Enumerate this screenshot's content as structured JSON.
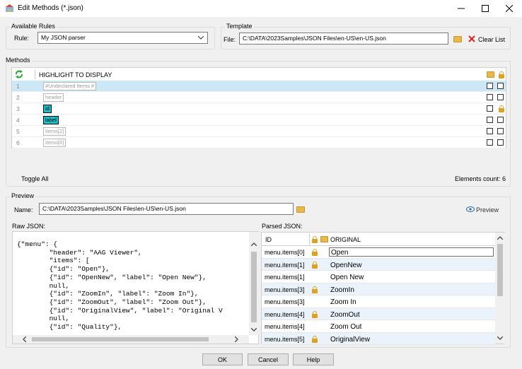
{
  "window": {
    "title": "Edit Methods (*.json)"
  },
  "available_rules": {
    "group_label": "Available Rules",
    "rule_label": "Rule:",
    "rule_value": "My JSON parser"
  },
  "template": {
    "group_label": "Template",
    "file_label": "File:",
    "file_value": "C:\\DATA\\2023Samples\\JSON Files\\en-US\\en-US.json",
    "clear_label": "Clear List"
  },
  "methods": {
    "group_label": "Methods",
    "header_label": "HIGHLIGHT TO DISPLAY",
    "rows": [
      {
        "num": "1",
        "tag": "#Undeclared Items #",
        "style": "placeholder",
        "lock": false
      },
      {
        "num": "2",
        "tag": "header",
        "style": "plain",
        "lock": false
      },
      {
        "num": "3",
        "tag": "id",
        "style": "teal",
        "lock": true
      },
      {
        "num": "4",
        "tag": "label",
        "style": "teal",
        "lock": false
      },
      {
        "num": "5",
        "tag": "items[2]",
        "style": "plain",
        "lock": false
      },
      {
        "num": "6",
        "tag": "items[6]",
        "style": "plain",
        "lock": false
      }
    ],
    "toggle_all": "Toggle All",
    "elements_count": "Elements count: 6"
  },
  "preview": {
    "group_label": "Preview",
    "name_label": "Name:",
    "name_value": "C:\\DATA\\2023Samples\\JSON Files\\en-US\\en-US.json",
    "preview_label": "Preview",
    "raw_label": "Raw JSON:",
    "raw_lines": [
      "{\"menu\": {",
      "        \"header\": \"AAG Viewer\",",
      "        \"items\": [",
      "        {\"id\": \"Open\"},",
      "        {\"id\": \"OpenNew\", \"label\": \"Open New\"},",
      "        null,",
      "        {\"id\": \"ZoomIn\", \"label\": \"Zoom In\"},",
      "        {\"id\": \"ZoomOut\", \"label\": \"Zoom Out\"},",
      "        {\"id\": \"OriginalView\", \"label\": \"Original V",
      "        null,",
      "        {\"id\": \"Quality\"},"
    ],
    "parsed_label": "Parsed JSON:",
    "col_id": "ID",
    "col_original": "ORIGINAL",
    "parsed_rows": [
      {
        "id": "menu.items[0]",
        "lock": true,
        "original": "Open",
        "selected": true
      },
      {
        "id": "menu.items[1]",
        "lock": true,
        "original": "OpenNew",
        "selected": false
      },
      {
        "id": "menu.items[1]",
        "lock": false,
        "original": "Open New",
        "selected": false
      },
      {
        "id": "menu.items[3]",
        "lock": true,
        "original": "ZoomIn",
        "selected": false
      },
      {
        "id": "menu.items[3]",
        "lock": false,
        "original": "Zoom In",
        "selected": false
      },
      {
        "id": "menu.items[4]",
        "lock": true,
        "original": "ZoomOut",
        "selected": false
      },
      {
        "id": "menu.items[4]",
        "lock": false,
        "original": "Zoom Out",
        "selected": false
      },
      {
        "id": "menu.items[5]",
        "lock": true,
        "original": "OriginalView",
        "selected": false
      }
    ]
  },
  "buttons": {
    "ok": "OK",
    "cancel": "Cancel",
    "help": "Help"
  },
  "colors": {
    "selected_row": "#cce8f7",
    "teal_tag": "#17c0c8",
    "alt_row": "#eaf3fb",
    "accent": "#2a6fb5"
  }
}
